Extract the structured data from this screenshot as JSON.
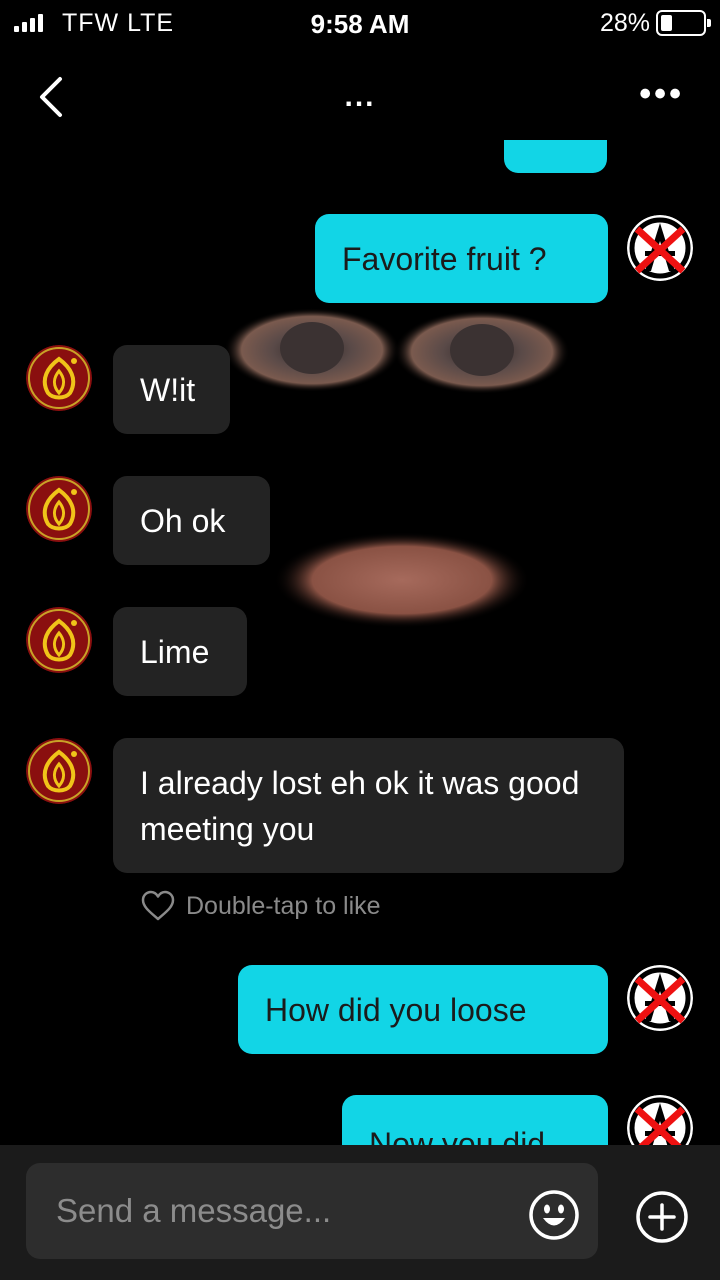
{
  "status": {
    "carrier": "TFW  LTE",
    "time": "9:58 AM",
    "battery": "28%",
    "battery_level": 0.28
  },
  "nav": {
    "title": "...",
    "more": "•••"
  },
  "messages": [
    {
      "from": "me",
      "text": "Favorite fruit ?"
    },
    {
      "from": "them",
      "text": "W!it"
    },
    {
      "from": "them",
      "text": "Oh ok"
    },
    {
      "from": "them",
      "text": "Lime"
    },
    {
      "from": "them",
      "text": "I already lost eh ok it was good meeting you"
    },
    {
      "from": "me",
      "text": "How did you loose"
    },
    {
      "from": "me",
      "text": "Now you did"
    }
  ],
  "like_hint": "Double-tap to like",
  "composer": {
    "placeholder": "Send a message..."
  },
  "icons": {
    "back": "chevron-left-icon",
    "more": "more-horizontal-icon",
    "heart": "heart-outline-icon",
    "emoji": "smiley-icon",
    "add": "plus-circle-icon"
  },
  "colors": {
    "outgoing_bubble": "#12d5e6",
    "incoming_bubble": "#232323",
    "background": "#000000"
  }
}
